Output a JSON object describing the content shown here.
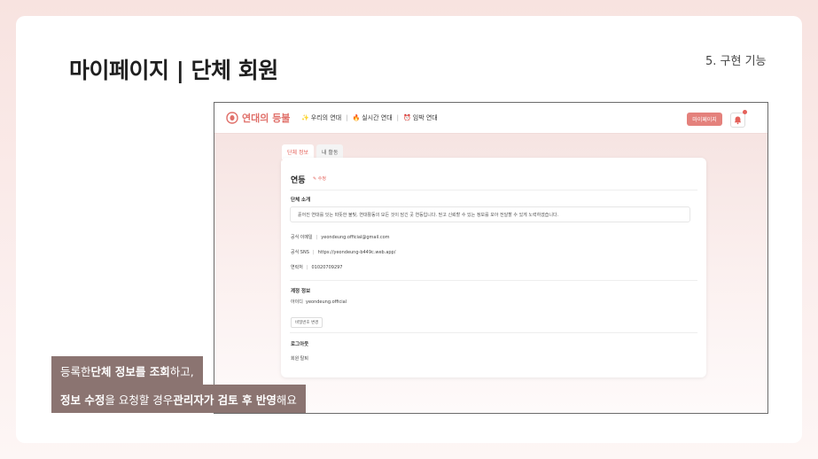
{
  "slide": {
    "title": "마이페이지 | 단체 회원",
    "section": "5. 구현 기능"
  },
  "navbar": {
    "logo_text": "연대의 등불",
    "menu": [
      {
        "emoji": "✨",
        "label": "우리의 연대"
      },
      {
        "emoji": "🔥",
        "label": "실시간 연대"
      },
      {
        "emoji": "⏰",
        "label": "임박 연대"
      }
    ],
    "separator": "|",
    "mypage_label": "마이페이지"
  },
  "tabs": [
    "단체 정보",
    "내 활동"
  ],
  "org": {
    "name": "연등",
    "edit_label": "✎ 수정",
    "intro_title": "단체 소개",
    "intro_text": "흩어진 연대를 잇는 따뜻한 불빛, 연대활동의 모든 것이 담긴 곳 연등입니다. 믿고 신뢰할 수 있는 정보를 모아 전달할 수 있게 노력하겠습니다.",
    "email_label": "공식 이메일",
    "email": "yeondeung.official@gmail.com",
    "sns_label": "공식 SNS",
    "sns": "https://yeondeung-b449c.web.app/",
    "phone_label": "연락처",
    "phone": "01020709297"
  },
  "account": {
    "title": "계정 정보",
    "id_label": "아이디",
    "id_value": "yeondeung.official",
    "password_button": "비밀번호 변경",
    "logout": "로그아웃",
    "withdraw": "회원 탈퇴"
  },
  "caption": {
    "line1": [
      {
        "text": "등록한 ",
        "bold": false
      },
      {
        "text": "단체 정보를 조회",
        "bold": true
      },
      {
        "text": "하고,",
        "bold": false
      }
    ],
    "line2": [
      {
        "text": "정보 수정",
        "bold": true
      },
      {
        "text": "을 요청할 경우 ",
        "bold": false
      },
      {
        "text": "관리자가 검토 후 반영",
        "bold": true
      },
      {
        "text": "해요",
        "bold": false
      }
    ]
  },
  "colors": {
    "accent": "#e4615a",
    "button": "#e4817c",
    "caption_bg": "#8b7471"
  }
}
